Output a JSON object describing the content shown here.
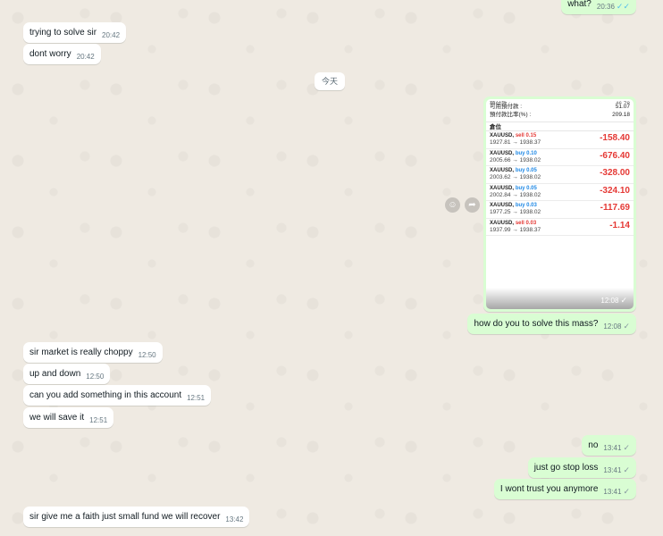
{
  "date_divider": "今天",
  "messages_top": [
    {
      "dir": "out",
      "text": "what?",
      "time": "20:36",
      "tick": "✓✓",
      "tick_color": "blue"
    },
    {
      "dir": "in",
      "text": "trying to solve sir",
      "time": "20:42"
    },
    {
      "dir": "in",
      "text": "dont worry",
      "time": "20:42"
    }
  ],
  "image_message": {
    "time": "12:08",
    "tick": "✓",
    "summary": [
      {
        "label": "預付款 :",
        "value": "46.78"
      },
      {
        "label": "可用預付款 :",
        "value": "51.07"
      },
      {
        "label": "預付款比率(%) :",
        "value": "209.18"
      }
    ],
    "section_title": "倉位",
    "positions": [
      {
        "symbol": "XAUUSD,",
        "side": "sell 0.15",
        "type": "sell",
        "prices": "1927.81 → 1938.37",
        "pl": "-158.40"
      },
      {
        "symbol": "XAUUSD,",
        "side": "buy 0.10",
        "type": "buy",
        "prices": "2005.66 → 1938.02",
        "pl": "-676.40"
      },
      {
        "symbol": "XAUUSD,",
        "side": "buy 0.05",
        "type": "buy",
        "prices": "2003.62 → 1938.02",
        "pl": "-328.00"
      },
      {
        "symbol": "XAUUSD,",
        "side": "buy 0.05",
        "type": "buy",
        "prices": "2002.84 → 1938.02",
        "pl": "-324.10"
      },
      {
        "symbol": "XAUUSD,",
        "side": "buy 0.03",
        "type": "buy",
        "prices": "1977.25 → 1938.02",
        "pl": "-117.69"
      },
      {
        "symbol": "XAUUSD,",
        "side": "sell 0.03",
        "type": "sell",
        "prices": "1937.99 → 1938.37",
        "pl": "-1.14"
      }
    ]
  },
  "messages_bottom": [
    {
      "dir": "out",
      "text": "how do you to solve this mass?",
      "time": "12:08",
      "tick": "✓"
    },
    {
      "dir": "in",
      "text": "sir market is really choppy",
      "time": "12:50"
    },
    {
      "dir": "in",
      "text": "up and down",
      "time": "12:50"
    },
    {
      "dir": "in",
      "text": "can you add something in this account",
      "time": "12:51"
    },
    {
      "dir": "in",
      "text": "we will save it",
      "time": "12:51"
    },
    {
      "dir": "out",
      "text": "no",
      "time": "13:41",
      "tick": "✓"
    },
    {
      "dir": "out",
      "text": "just go stop loss",
      "time": "13:41",
      "tick": "✓"
    },
    {
      "dir": "out",
      "text": "I wont trust you anymore",
      "time": "13:41",
      "tick": "✓"
    },
    {
      "dir": "in",
      "text": "sir give me a faith just small fund we will recover",
      "time": "13:42"
    }
  ],
  "icons": {
    "emoji": "emoji-icon",
    "forward": "forward-icon"
  },
  "colors": {
    "incoming_bubble": "#ffffff",
    "outgoing_bubble": "#d9fdd3",
    "chat_background": "#efeae2",
    "loss_red": "#e53935",
    "buy_blue": "#1e88e5",
    "read_tick": "#53bdeb"
  }
}
